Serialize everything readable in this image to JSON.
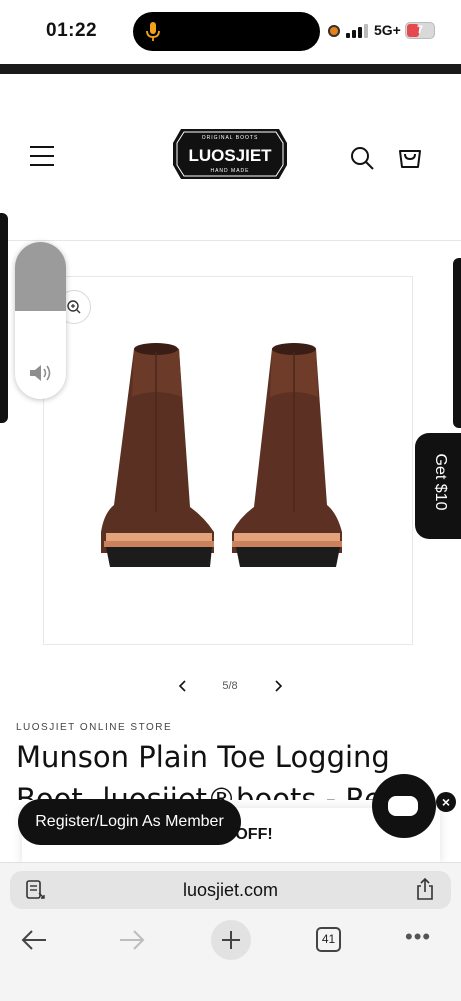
{
  "status_bar": {
    "time": "01:22",
    "network": "5G+",
    "battery": "7"
  },
  "header": {
    "logo_text": "LUOSJIET",
    "logo_tagline_top": "ORIGINAL BOOTS",
    "logo_tagline_bottom": "HAND MADE"
  },
  "gallery": {
    "page_indicator": "5/8",
    "current_index": 5,
    "total": 8
  },
  "side_tab": {
    "label": "Get $10"
  },
  "product": {
    "vendor": "LUOSJIET ONLINE STORE",
    "title": "Munson Plain Toe Logging Boot- luosjiet®boots - Red"
  },
  "promo": {
    "banner_text": "0 OFF!",
    "register_label": "Register/Login As Member"
  },
  "browser": {
    "url": "luosjiet.com",
    "tab_count": "41"
  },
  "colors": {
    "accent_black": "#111111",
    "mic_orange": "#f2a21b",
    "battery_red": "#e5484d"
  }
}
